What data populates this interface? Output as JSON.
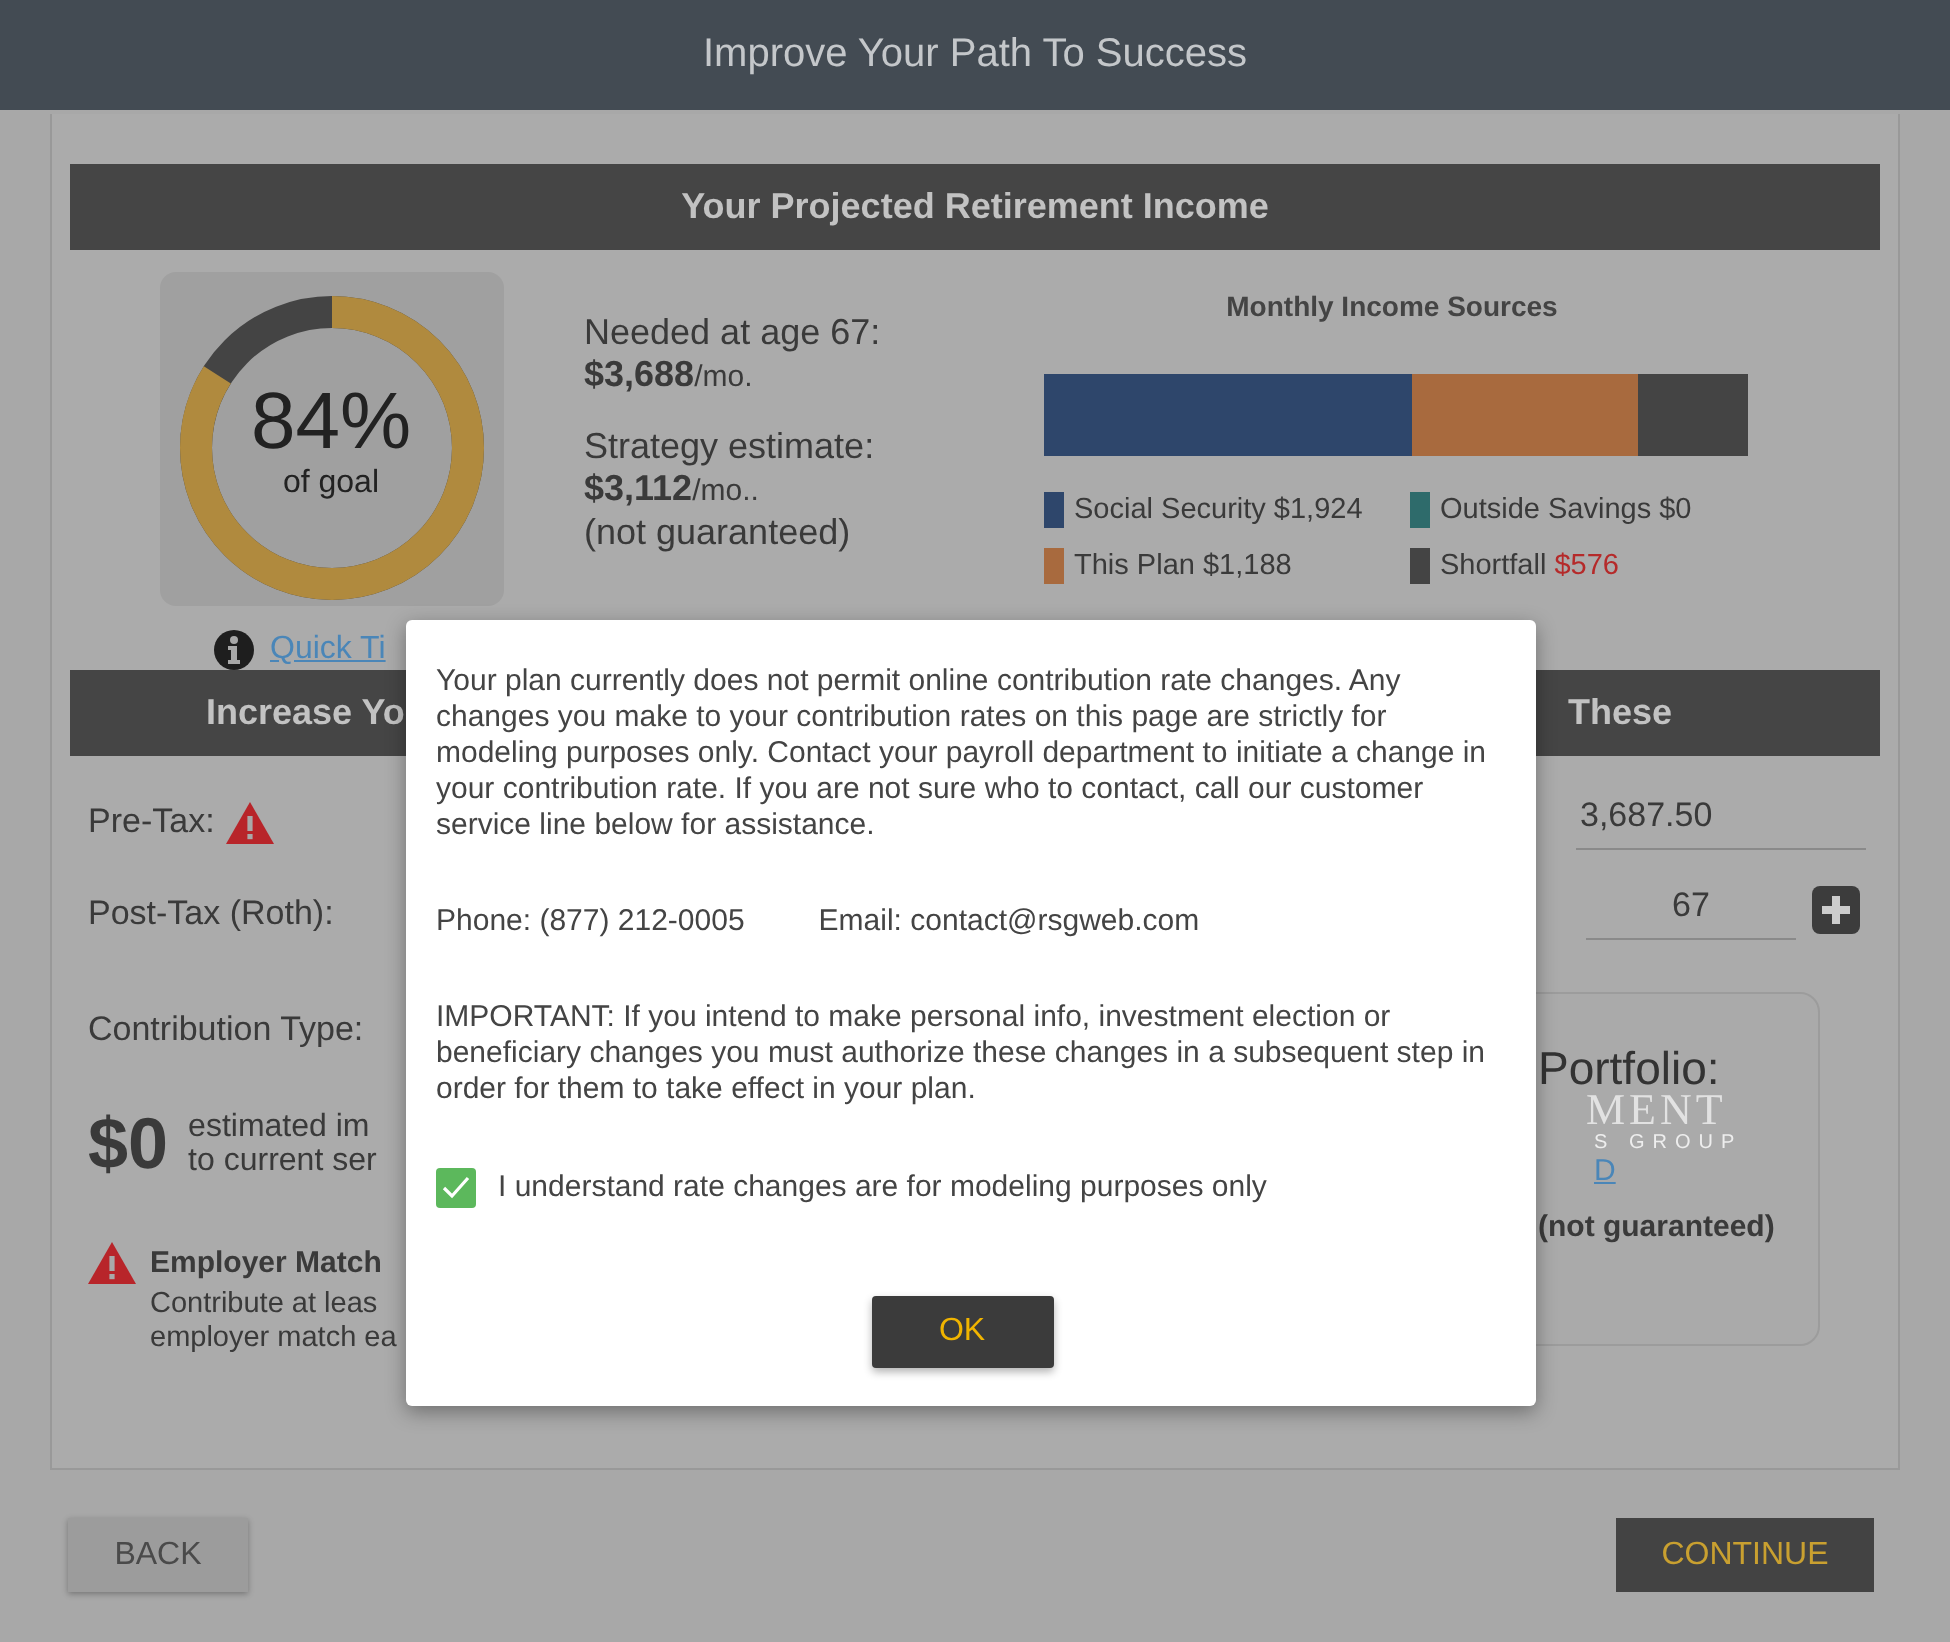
{
  "header": {
    "title": "Improve Your Path To Success"
  },
  "income": {
    "title": "Your Projected Retirement Income",
    "goal": {
      "percent": "84%",
      "caption": "of goal",
      "level": 0.84
    },
    "needed": {
      "label": "Needed at age 67:",
      "amount": "$3,688",
      "unit": "/mo."
    },
    "estimate": {
      "label": "Strategy estimate:",
      "amount": "$3,112",
      "unit": "/mo..",
      "note": "(not guaranteed)"
    },
    "sources_title": "Monthly Income Sources",
    "legend": [
      {
        "label": "Social Security $1,924",
        "color": "#2e466b"
      },
      {
        "label": "Outside Savings $0",
        "color": "#2e6b6b"
      },
      {
        "label": "This Plan $1,188",
        "color": "#a86a3e"
      },
      {
        "label": "Shortfall",
        "amount": "$576",
        "color": "#444444"
      }
    ]
  },
  "quick_tip": {
    "label": "Quick Ti"
  },
  "contribution": {
    "title_left": "Increase Yo",
    "title_right": "These",
    "rows": [
      {
        "label": "Pre-Tax:",
        "warning": true
      },
      {
        "label": "Post-Tax (Roth):",
        "warning": false
      },
      {
        "label": "Contribution Type:",
        "warning": false
      }
    ],
    "impact": {
      "amount": "$0",
      "lines": [
        "estimated im",
        "to current ser"
      ]
    },
    "employer_match": {
      "title": "Employer Match",
      "lines": [
        "Contribute at leas",
        "employer match ea"
      ]
    },
    "income_goal": {
      "value": "3,687.50"
    },
    "retirement_age": {
      "value": "67"
    },
    "portfolio": {
      "title": "Portfolio:",
      "logo_lines": [
        "MENT",
        "S GROUP"
      ],
      "link": "D",
      "note": "(not guaranteed)"
    }
  },
  "modal": {
    "message": "Your plan currently does not permit online contribution rate changes. Any changes you make to your contribution rates on this page are strictly for modeling purposes only. Contact your payroll department to initiate a change in your contribution rate. If you are not sure who to contact, call our customer service line below for assistance.",
    "phone": "Phone: (877) 212-0005",
    "email": "Email: contact@rsgweb.com",
    "important": "IMPORTANT: If you intend to make personal info, investment election or beneficiary changes you must authorize these changes in a subsequent step in order for them to take effect in your plan.",
    "checkbox": {
      "label": "I understand rate changes are for modeling purposes only",
      "checked": true
    },
    "ok": "OK"
  },
  "footer": {
    "back": "BACK",
    "continue": "CONTINUE"
  }
}
